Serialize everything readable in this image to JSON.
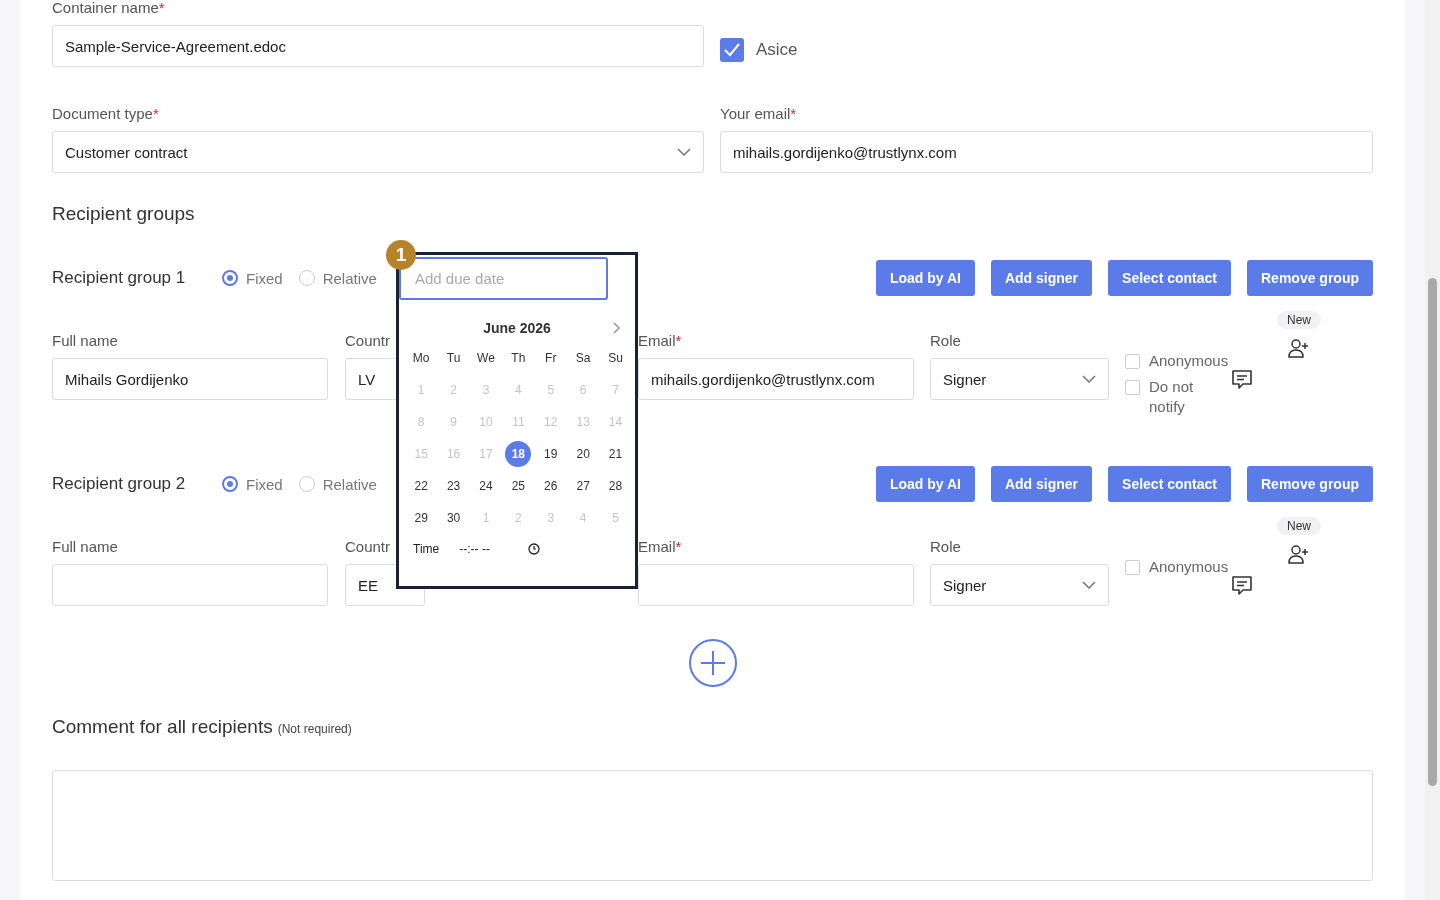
{
  "container_name": {
    "label": "Container name",
    "required_mark": "*",
    "value": "Sample-Service-Agreement.edoc"
  },
  "asice": {
    "label": "Asice",
    "checked": true
  },
  "document_type": {
    "label": "Document type",
    "required_mark": "*",
    "value": "Customer contract"
  },
  "your_email": {
    "label": "Your email",
    "required_mark": "*",
    "value": "mihails.gordijenko@trustlynx.com"
  },
  "recipient_groups_title": "Recipient groups",
  "groups": [
    {
      "title": "Recipient group 1",
      "modes": [
        {
          "label": "Fixed",
          "selected": true
        },
        {
          "label": "Relative",
          "selected": false
        }
      ],
      "buttons": [
        "Load by AI",
        "Add signer",
        "Select contact",
        "Remove group"
      ],
      "full_name": {
        "label": "Full name",
        "value": "Mihails Gordijenko"
      },
      "country": {
        "label": "Countr",
        "value": "LV"
      },
      "email": {
        "label": "Email",
        "required_mark": "*",
        "value": "mihails.gordijenko@trustlynx.com"
      },
      "role": {
        "label": "Role",
        "value": "Signer"
      },
      "options": [
        {
          "label": "Anonymous",
          "checked": false
        },
        {
          "label": "Do not notify",
          "checked": false
        }
      ],
      "new_badge": "New"
    },
    {
      "title": "Recipient group 2",
      "modes": [
        {
          "label": "Fixed",
          "selected": true
        },
        {
          "label": "Relative",
          "selected": false
        }
      ],
      "buttons": [
        "Load by AI",
        "Add signer",
        "Select contact",
        "Remove group"
      ],
      "full_name": {
        "label": "Full name"
      },
      "country": {
        "label": "Countr",
        "value": "EE"
      },
      "email": {
        "label": "Email",
        "required_mark": "*"
      },
      "role": {
        "label": "Role",
        "value": "Signer"
      },
      "options": [
        {
          "label": "Anonymous",
          "checked": false
        }
      ],
      "new_badge": "New"
    }
  ],
  "comment": {
    "title": "Comment for all recipients",
    "note": "(Not required)"
  },
  "date_picker": {
    "step_badge": "1",
    "placeholder": "Add due date",
    "month": "June 2026",
    "weekdays": [
      "Mo",
      "Tu",
      "We",
      "Th",
      "Fr",
      "Sa",
      "Su"
    ],
    "days": [
      {
        "day": "1",
        "muted": true,
        "selected": false
      },
      {
        "day": "2",
        "muted": true,
        "selected": false
      },
      {
        "day": "3",
        "muted": true,
        "selected": false
      },
      {
        "day": "4",
        "muted": true,
        "selected": false
      },
      {
        "day": "5",
        "muted": true,
        "selected": false
      },
      {
        "day": "6",
        "muted": true,
        "selected": false
      },
      {
        "day": "7",
        "muted": true,
        "selected": false
      },
      {
        "day": "8",
        "muted": true,
        "selected": false
      },
      {
        "day": "9",
        "muted": true,
        "selected": false
      },
      {
        "day": "10",
        "muted": true,
        "selected": false
      },
      {
        "day": "11",
        "muted": true,
        "selected": false
      },
      {
        "day": "12",
        "muted": true,
        "selected": false
      },
      {
        "day": "13",
        "muted": true,
        "selected": false
      },
      {
        "day": "14",
        "muted": true,
        "selected": false
      },
      {
        "day": "15",
        "muted": true,
        "selected": false
      },
      {
        "day": "16",
        "muted": true,
        "selected": false
      },
      {
        "day": "17",
        "muted": true,
        "selected": false
      },
      {
        "day": "18",
        "muted": false,
        "selected": true
      },
      {
        "day": "19",
        "muted": false,
        "selected": false
      },
      {
        "day": "20",
        "muted": false,
        "selected": false
      },
      {
        "day": "21",
        "muted": false,
        "selected": false
      },
      {
        "day": "22",
        "muted": false,
        "selected": false
      },
      {
        "day": "23",
        "muted": false,
        "selected": false
      },
      {
        "day": "24",
        "muted": false,
        "selected": false
      },
      {
        "day": "25",
        "muted": false,
        "selected": false
      },
      {
        "day": "26",
        "muted": false,
        "selected": false
      },
      {
        "day": "27",
        "muted": false,
        "selected": false
      },
      {
        "day": "28",
        "muted": false,
        "selected": false
      },
      {
        "day": "29",
        "muted": false,
        "selected": false
      },
      {
        "day": "30",
        "muted": false,
        "selected": false
      },
      {
        "day": "1",
        "muted": true,
        "selected": false
      },
      {
        "day": "2",
        "muted": true,
        "selected": false
      },
      {
        "day": "3",
        "muted": true,
        "selected": false
      },
      {
        "day": "4",
        "muted": true,
        "selected": false
      },
      {
        "day": "5",
        "muted": true,
        "selected": false
      }
    ],
    "time_label": "Time",
    "time_value": "--:-- --"
  }
}
